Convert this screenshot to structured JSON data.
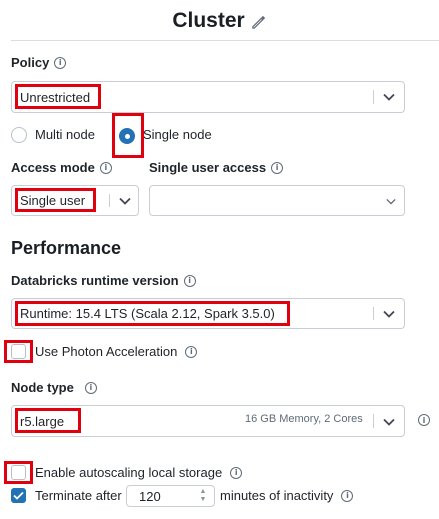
{
  "header": {
    "title": "Cluster",
    "edit_icon": "pencil-icon"
  },
  "policy": {
    "label": "Policy",
    "value": "Unrestricted"
  },
  "node_mode": {
    "multi_label": "Multi node",
    "single_label": "Single node",
    "selected": "single"
  },
  "access_mode": {
    "label": "Access mode",
    "value": "Single user"
  },
  "single_user_access": {
    "label": "Single user access",
    "value": ""
  },
  "performance": {
    "title": "Performance",
    "runtime_label": "Databricks runtime version",
    "runtime_value": "Runtime: 15.4 LTS (Scala 2.12, Spark 3.5.0)",
    "photon_label": "Use Photon Acceleration",
    "photon_checked": false
  },
  "node_type": {
    "label": "Node type",
    "value": "r5.large",
    "detail": "16 GB Memory, 2 Cores"
  },
  "autoscaling_storage": {
    "label": "Enable autoscaling local storage",
    "checked": false
  },
  "terminate": {
    "label_before": "Terminate after",
    "minutes": "120",
    "label_after": "minutes of inactivity",
    "checked": true
  },
  "colors": {
    "accent": "#2272b4",
    "highlight": "#e0000e",
    "border": "#c9ced6"
  }
}
